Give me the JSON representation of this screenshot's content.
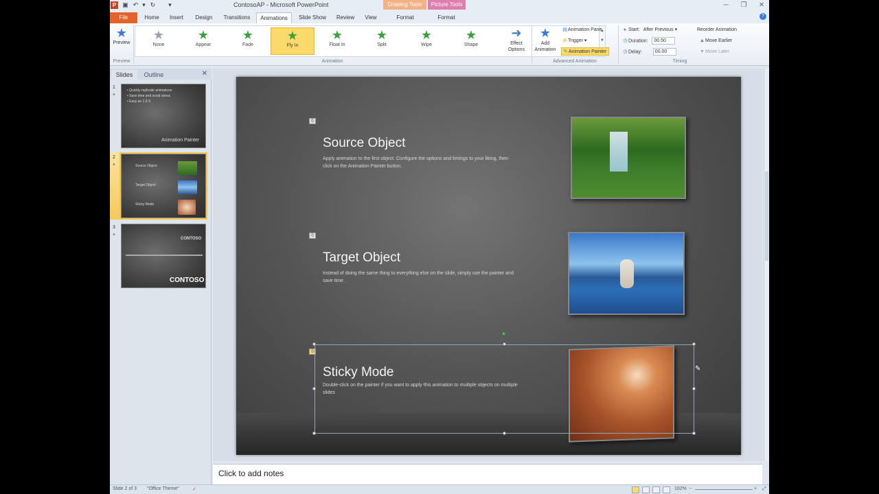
{
  "window": {
    "title": "ContosoAP - Microsoft PowerPoint",
    "context_tabs": [
      "Drawing Tools",
      "Picture Tools"
    ],
    "controls": [
      "─",
      "❐",
      "✕"
    ]
  },
  "tabs": [
    "File",
    "Home",
    "Insert",
    "Design",
    "Transitions",
    "Animations",
    "Slide Show",
    "Review",
    "View",
    "Format",
    "Format"
  ],
  "active_tab": "Animations",
  "ribbon": {
    "preview": {
      "label": "Preview",
      "group": "Preview"
    },
    "animations": [
      "None",
      "Appear",
      "Fade",
      "Fly In",
      "Float In",
      "Split",
      "Wipe",
      "Shape"
    ],
    "selected_animation": "Fly In",
    "effect_options": "Effect Options",
    "animation_group": "Animation",
    "add_animation": "Add Animation",
    "animation_pane": "Animation Pane",
    "trigger": "Trigger",
    "animation_painter": "Animation Painter",
    "advanced_group": "Advanced Animation",
    "timing": {
      "start_label": "Start:",
      "start_value": "After Previous",
      "duration_label": "Duration:",
      "duration_value": "00.50",
      "delay_label": "Delay:",
      "delay_value": "00.00",
      "group": "Timing"
    },
    "reorder": {
      "title": "Reorder Animation",
      "earlier": "Move Earlier",
      "later": "Move Later"
    }
  },
  "slides_pane": {
    "tabs": [
      "Slides",
      "Outline"
    ],
    "thumbnails": [
      {
        "number": "1",
        "lines": [
          "• Quickly replicate animations",
          "• Save time and avoid stress",
          "• Easy as 1-2-3"
        ],
        "footer": "Animation Painter"
      },
      {
        "number": "2",
        "lines": [
          "Source Object",
          "Target Object",
          "Sticky Mode"
        ]
      },
      {
        "number": "3",
        "header": "CONTOSO",
        "footer": "CONTOSO"
      }
    ]
  },
  "slide": {
    "items": [
      {
        "title": "Source Object",
        "body": "Apply animation to the first object.  Configure the options and timings to your liking, then click on the Animation Painter button."
      },
      {
        "title": "Target Object",
        "body": "Instead of doing the same thing to everything else on the slide, simply use the painter and save time."
      },
      {
        "title": "Sticky Mode",
        "body": "Double-click on the painter if you want to apply this animation to multiple objects on multiple slides"
      }
    ]
  },
  "notes": {
    "placeholder": "Click to add notes"
  },
  "status": {
    "slide": "Slide 2 of 3",
    "theme": "\"Office Theme\"",
    "zoom": "102%"
  }
}
